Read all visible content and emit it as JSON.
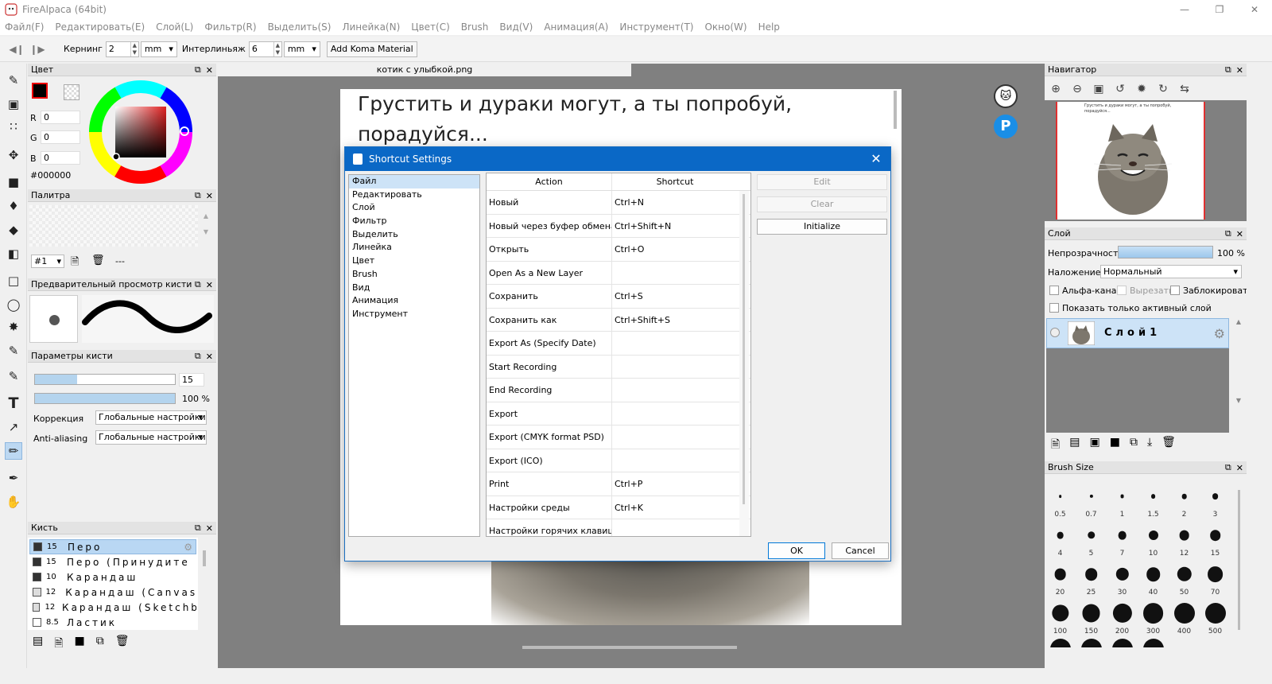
{
  "window": {
    "title": "FireAlpaca (64bit)"
  },
  "menu": [
    "Файл(F)",
    "Редактировать(E)",
    "Слой(L)",
    "Фильтр(R)",
    "Выделить(S)",
    "Линейка(N)",
    "Цвет(C)",
    "Brush",
    "Вид(V)",
    "Анимация(A)",
    "Инструмент(T)",
    "Окно(W)",
    "Help"
  ],
  "toolbar": {
    "kerning_label": "Кернинг",
    "kerning_value": "2",
    "kerning_unit": "mm",
    "leading_label": "Интерлиньяж",
    "leading_value": "6",
    "leading_unit": "mm",
    "koma_button": "Add Koma Material"
  },
  "color_panel": {
    "title": "Цвет",
    "r_label": "R",
    "r_value": "0",
    "g_label": "G",
    "g_value": "0",
    "b_label": "B",
    "b_value": "0",
    "hex": "#000000",
    "fg_color": "#000000"
  },
  "palette_panel": {
    "title": "Палитра",
    "page": "#1",
    "dash": "---"
  },
  "brush_preview_panel": {
    "title": "Предварительный просмотр кисти"
  },
  "brush_params_panel": {
    "title": "Параметры кисти",
    "size_value": "15",
    "opacity_value": "100 %",
    "size_level": 0.3,
    "opacity_level": 1.0,
    "correction_label": "Коррекция",
    "correction_value": "Глобальные настройки",
    "aa_label": "Anti-aliasing",
    "aa_value": "Глобальные настройки"
  },
  "brush_panel": {
    "title": "Кисть",
    "items": [
      {
        "size": "15",
        "name": "Перо",
        "selected": true
      },
      {
        "size": "15",
        "name": "Перо (Принудите"
      },
      {
        "size": "10",
        "name": "Карандаш"
      },
      {
        "size": "12",
        "name": "Карандаш (Canvas)"
      },
      {
        "size": "12",
        "name": "Карандаш (Sketchbook"
      },
      {
        "size": "8.5",
        "name": "Ластик"
      }
    ]
  },
  "canvas": {
    "tab_title": "котик с улыбкой.png",
    "text_line1": "Грустить и дураки могут, а ты попробуй,",
    "text_line2": "порадуйся..."
  },
  "dialog": {
    "title": "Shortcut Settings",
    "categories": [
      "Файл",
      "Редактировать",
      "Слой",
      "Фильтр",
      "Выделить",
      "Линейка",
      "Цвет",
      "Brush",
      "Вид",
      "Анимация",
      "Инструмент"
    ],
    "col_action": "Action",
    "col_shortcut": "Shortcut",
    "rows": [
      {
        "action": "Новый",
        "shortcut": "Ctrl+N"
      },
      {
        "action": "Новый через буфер обмена",
        "shortcut": "Ctrl+Shift+N"
      },
      {
        "action": "Открыть",
        "shortcut": "Ctrl+O"
      },
      {
        "action": "Open As a New Layer",
        "shortcut": ""
      },
      {
        "action": "Сохранить",
        "shortcut": "Ctrl+S"
      },
      {
        "action": "Сохранить как",
        "shortcut": "Ctrl+Shift+S"
      },
      {
        "action": "Export As (Specify Date)",
        "shortcut": ""
      },
      {
        "action": "Start Recording",
        "shortcut": ""
      },
      {
        "action": "End Recording",
        "shortcut": ""
      },
      {
        "action": "Export",
        "shortcut": ""
      },
      {
        "action": "Export (CMYK format PSD)",
        "shortcut": ""
      },
      {
        "action": "Export (ICO)",
        "shortcut": ""
      },
      {
        "action": "Print",
        "shortcut": "Ctrl+P"
      },
      {
        "action": "Настройки среды",
        "shortcut": "Ctrl+K"
      },
      {
        "action": "Настройки горячих клавиш",
        "shortcut": ""
      }
    ],
    "edit_button": "Edit",
    "clear_button": "Clear",
    "initialize_button": "Initialize",
    "ok_button": "OK",
    "cancel_button": "Cancel"
  },
  "navigator_panel": {
    "title": "Навигатор",
    "preview_text": "Грустить и дураки могут, а ты попробуй, порадуйся..."
  },
  "layer_panel": {
    "title": "Слой",
    "opacity_label": "Непрозрачность",
    "opacity_value": "100 %",
    "opacity_level": 1.0,
    "blend_label": "Наложение",
    "blend_value": "Нормальный",
    "alpha_label": "Альфа-кана.",
    "clip_label": "Вырезать",
    "lock_label": "Заблокироват",
    "show_active_label": "Показать только активный слой",
    "layer_name": "Слой1"
  },
  "brush_size_panel": {
    "title": "Brush Size",
    "sizes": [
      "0.5",
      "0.7",
      "1",
      "1.5",
      "2",
      "3",
      "4",
      "5",
      "7",
      "10",
      "12",
      "15",
      "20",
      "25",
      "30",
      "40",
      "50",
      "70",
      "100",
      "150",
      "200",
      "300",
      "400",
      "500"
    ]
  }
}
